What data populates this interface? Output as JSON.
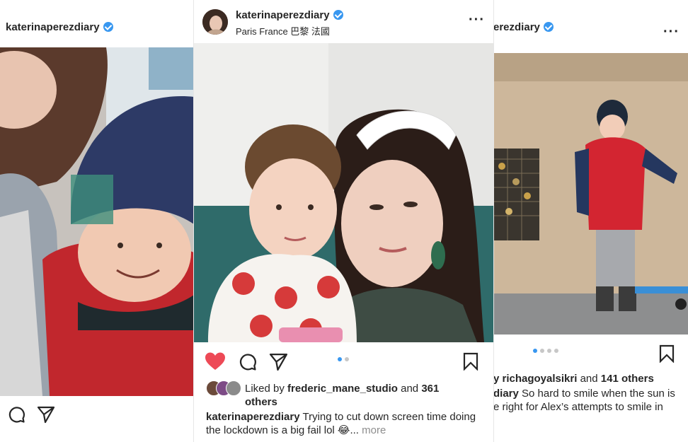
{
  "left_post": {
    "username": "katerinaperezdiary"
  },
  "center_post": {
    "username": "katerinaperezdiary",
    "location": "Paris France 巴黎 法國",
    "liked_by_prefix": "Liked by",
    "liked_by_user": "frederic_mane_studio",
    "liked_by_and": "and",
    "liked_by_count": "361",
    "liked_by_suffix": "others",
    "caption_user": "katerinaperezdiary",
    "caption_text": "Trying to cut down screen time doing the lockdown is a big fail lol 😂...",
    "more_label": "more",
    "carousel_total": 2,
    "carousel_active": 1
  },
  "right_post": {
    "username_partial": "erezdiary",
    "liked_by_user_partial": "y richagoyalsikri",
    "liked_by_and": "and",
    "liked_by_count": "141 others",
    "caption_user_partial": "diary",
    "caption_text": "So hard to smile when the sun is",
    "caption_line2": "e right for Alex’s attempts to smile in",
    "carousel_total": 4,
    "carousel_active": 1
  },
  "icons": {
    "like": "heart-icon",
    "comment": "comment-icon",
    "share": "send-icon",
    "save": "bookmark-icon",
    "menu": "more-options-icon",
    "verified": "verified-badge-icon"
  },
  "colors": {
    "like_red": "#ed4956",
    "verified_blue": "#3897f0",
    "active_dot": "#3897f0",
    "inactive_dot": "#c7c7c7"
  }
}
